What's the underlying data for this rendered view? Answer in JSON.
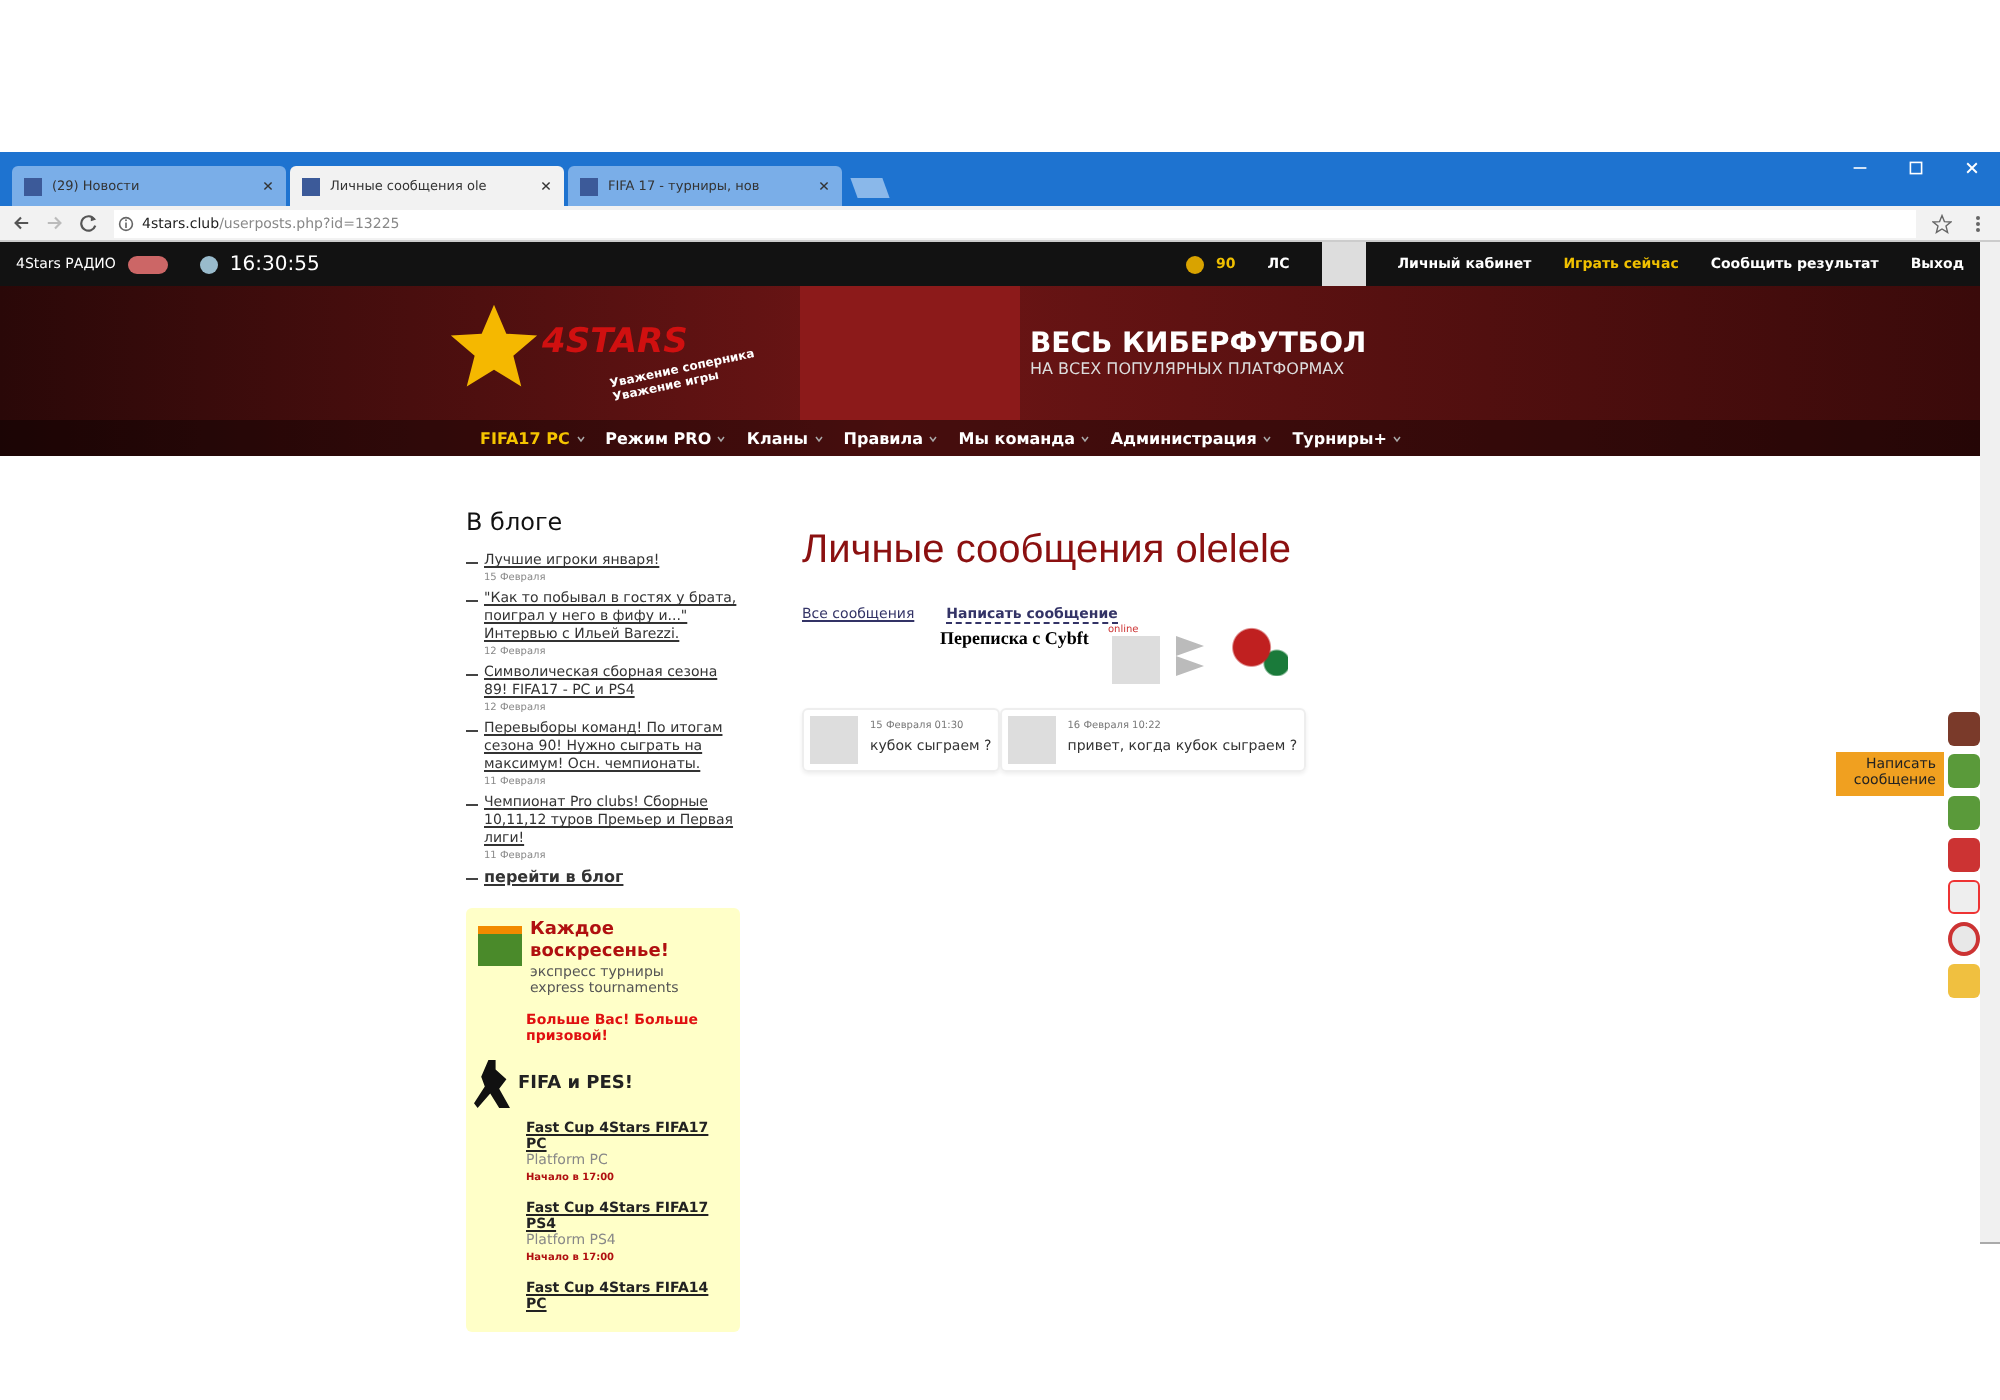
{
  "browser": {
    "tabs": [
      {
        "title": "(29) Новости",
        "selected": false
      },
      {
        "title": "Личные сообщения ole",
        "selected": true
      },
      {
        "title": "FIFA 17 - турниры, нов",
        "selected": false
      }
    ],
    "address": {
      "host": "4stars.club",
      "path": "/userposts.php?id=13225"
    }
  },
  "topbar": {
    "radio": "4Stars РАДИО",
    "time": "16:30:55",
    "coins": "90",
    "ls": "ЛС",
    "links": [
      {
        "label": "Личный кабинет",
        "highlight": false
      },
      {
        "label": "Играть сейчас",
        "highlight": true
      },
      {
        "label": "Сообщить результат",
        "highlight": false
      },
      {
        "label": "Выход",
        "highlight": false
      }
    ]
  },
  "banner": {
    "logo": "4STARS",
    "tagline": [
      "Уважение соперника",
      "Уважение игры"
    ],
    "headline": "ВЕСЬ КИБЕРФУТБОЛ",
    "subline": "НА ВСЕХ ПОПУЛЯРНЫХ ПЛАТФОРМАХ"
  },
  "nav": [
    {
      "label": "FIFA17 PC",
      "selected": true
    },
    {
      "label": "Режим PRO",
      "selected": false
    },
    {
      "label": "Кланы",
      "selected": false
    },
    {
      "label": "Правила",
      "selected": false
    },
    {
      "label": "Мы команда",
      "selected": false
    },
    {
      "label": "Администрация",
      "selected": false
    },
    {
      "label": "Турниры+",
      "selected": false
    }
  ],
  "blog": {
    "title": "В блоге",
    "posts": [
      {
        "title": "Лучшие игроки января!",
        "date": "15 Февраля"
      },
      {
        "title": "\"Как то побывал в гостях у брата, поиграл у него в фифу и...\" Интервью с Ильей Barezzi.",
        "date": "12 Февраля"
      },
      {
        "title": "Символическая сборная сезона 89! FIFA17 - PC и PS4",
        "date": "12 Февраля"
      },
      {
        "title": "Перевыборы команд! По итогам сезона 90! Нужно сыграть на максимум! Осн. чемпионаты.",
        "date": "11 Февраля"
      },
      {
        "title": "Чемпионат Pro clubs! Сборные 10,11,12 туров Премьер и Первая лиги!",
        "date": "11 Февраля"
      }
    ],
    "more": "перейти в блог"
  },
  "promo": {
    "heading": "Каждое воскресенье!",
    "sub": [
      "экспресс турниры",
      "express tournaments"
    ],
    "bonus": "Больше Вас! Больше призовой!",
    "section": "FIFA и PES!",
    "cups": [
      {
        "title": "Fast Cup 4Stars FIFA17 PC",
        "platform": "Platform PC",
        "start": "Начало в 17:00"
      },
      {
        "title": "Fast Cup 4Stars FIFA17 PS4",
        "platform": "Platform PS4",
        "start": "Начало в 17:00"
      },
      {
        "title": "Fast Cup 4Stars FIFA14 PC"
      }
    ]
  },
  "main": {
    "title": "Личные сообщения olelele",
    "links": [
      {
        "label": "Все сообщения",
        "selected": false
      },
      {
        "label": "Написать сообщение",
        "selected": true
      }
    ],
    "conversation": "Переписка с Cybft",
    "online": "online",
    "messages": [
      {
        "date": "15 Февраля 01:30",
        "text": "кубок сыграем ?"
      },
      {
        "date": "16 Февраля 10:22",
        "text": "привет, когда кубок сыграем ?"
      }
    ]
  },
  "side": {
    "write": "Написать сообщение"
  }
}
